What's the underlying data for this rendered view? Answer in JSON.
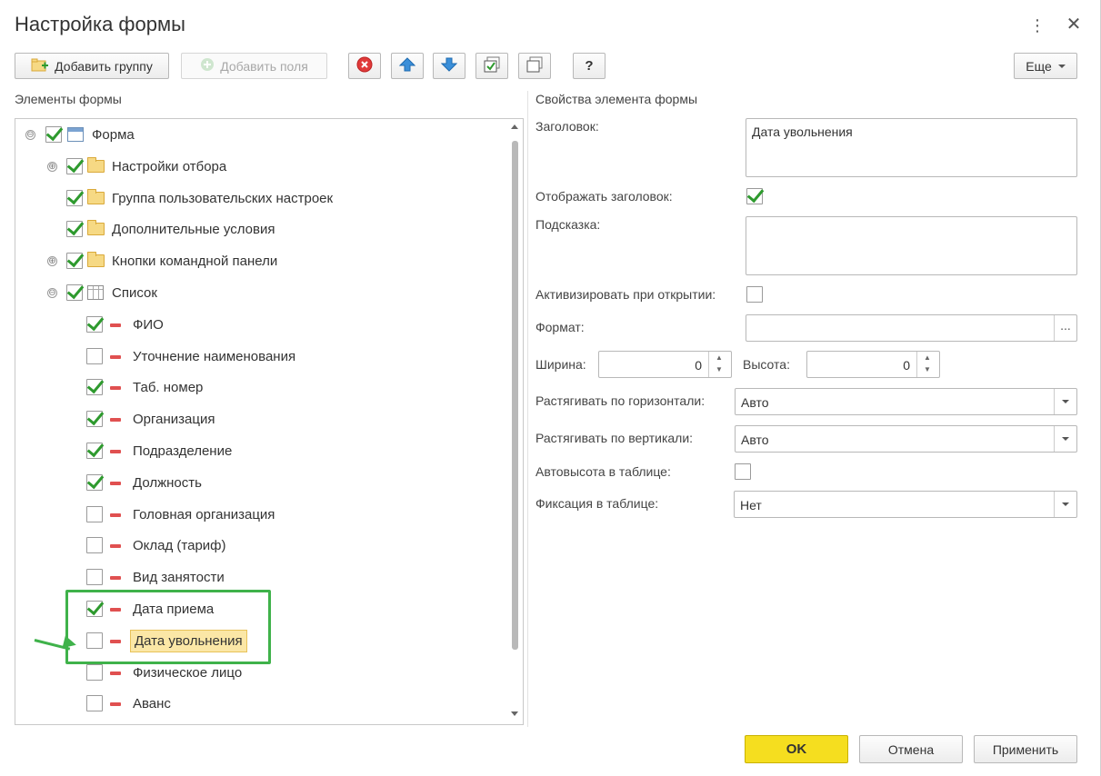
{
  "window": {
    "title": "Настройка формы",
    "menu_glyph": "⋮",
    "close_glyph": "✕"
  },
  "toolbar": {
    "add_group": "Добавить группу",
    "add_fields": "Добавить поля",
    "help": "?",
    "more": "Еще"
  },
  "left_panel": {
    "title": "Элементы формы"
  },
  "tree": {
    "items": [
      {
        "label": "Форма",
        "checked": true,
        "icon": "form-icon",
        "expander": "⊖"
      },
      {
        "label": "Настройки отбора",
        "checked": true,
        "icon": "folder-icon",
        "expander": "⊕"
      },
      {
        "label": "Группа пользовательских настроек",
        "checked": true,
        "icon": "folder-icon"
      },
      {
        "label": "Дополнительные условия",
        "checked": true,
        "icon": "folder-icon"
      },
      {
        "label": "Кнопки командной панели",
        "checked": true,
        "icon": "folder-icon",
        "expander": "⊕"
      },
      {
        "label": "Список",
        "checked": true,
        "icon": "table-icon",
        "expander": "⊖"
      },
      {
        "label": "ФИО",
        "checked": true,
        "icon": "field-icon"
      },
      {
        "label": "Уточнение наименования",
        "checked": false,
        "icon": "field-icon"
      },
      {
        "label": "Таб. номер",
        "checked": true,
        "icon": "field-icon"
      },
      {
        "label": "Организация",
        "checked": true,
        "icon": "field-icon"
      },
      {
        "label": "Подразделение",
        "checked": true,
        "icon": "field-icon"
      },
      {
        "label": "Должность",
        "checked": true,
        "icon": "field-icon"
      },
      {
        "label": "Головная организация",
        "checked": false,
        "icon": "field-icon"
      },
      {
        "label": "Оклад (тариф)",
        "checked": false,
        "icon": "field-icon"
      },
      {
        "label": "Вид занятости",
        "checked": false,
        "icon": "field-icon"
      },
      {
        "label": "Дата приема",
        "checked": true,
        "icon": "field-icon"
      },
      {
        "label": "Дата увольнения",
        "checked": false,
        "icon": "field-icon",
        "selected": true
      },
      {
        "label": "Физическое лицо",
        "checked": false,
        "icon": "field-icon"
      },
      {
        "label": "Аванс",
        "checked": false,
        "icon": "field-icon"
      }
    ]
  },
  "properties": {
    "title": "Свойства элемента формы",
    "caption_label": "Заголовок:",
    "caption_value": "Дата увольнения",
    "show_caption_label": "Отображать заголовок:",
    "show_caption_checked": true,
    "hint_label": "Подсказка:",
    "hint_value": "",
    "activate_label": "Активизировать при открытии:",
    "activate_checked": false,
    "format_label": "Формат:",
    "format_value": "",
    "format_button": "...",
    "width_label": "Ширина:",
    "width_value": "0",
    "height_label": "Высота:",
    "height_value": "0",
    "hstretch_label": "Растягивать по горизонтали:",
    "hstretch_value": "Авто",
    "vstretch_label": "Растягивать по вертикали:",
    "vstretch_value": "Авто",
    "autoheight_label": "Автовысота в таблице:",
    "autoheight_checked": false,
    "fix_label": "Фиксация в таблице:",
    "fix_value": "Нет"
  },
  "footer": {
    "ok": "OK",
    "cancel": "Отмена",
    "apply": "Применить"
  },
  "colors": {
    "accent_ok": "#f5de1f",
    "highlight_green": "#3fb24a",
    "check_green": "#2e9a2e",
    "selection": "#fbe7a6"
  }
}
